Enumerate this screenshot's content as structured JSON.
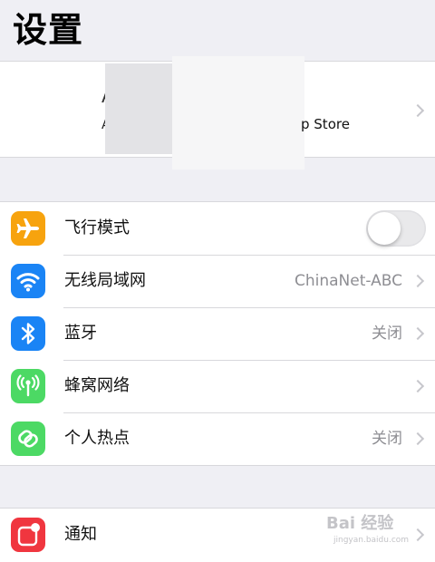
{
  "header": {
    "title": "设置"
  },
  "account": {
    "name_partial": "A",
    "subtitle_left": "A",
    "subtitle_right": "p Store"
  },
  "settings": [
    {
      "label": "飞行模式",
      "icon": "airplane-icon",
      "color": "#f7a30e",
      "toggle": false
    },
    {
      "label": "无线局域网",
      "icon": "wifi-icon",
      "color": "#1a84f5",
      "value": "ChinaNet-ABC"
    },
    {
      "label": "蓝牙",
      "icon": "bluetooth-icon",
      "color": "#1a84f5",
      "value": "关闭"
    },
    {
      "label": "蜂窝网络",
      "icon": "cellular-antenna-icon",
      "color": "#4cd964",
      "value": ""
    },
    {
      "label": "个人热点",
      "icon": "hotspot-link-icon",
      "color": "#4cd964",
      "value": "关闭"
    }
  ],
  "settings2": [
    {
      "label": "通知",
      "icon": "notifications-icon",
      "color": "#f0363f"
    }
  ],
  "watermark": {
    "text": "Bai 经验",
    "sub": "jingyan.baidu.com"
  }
}
